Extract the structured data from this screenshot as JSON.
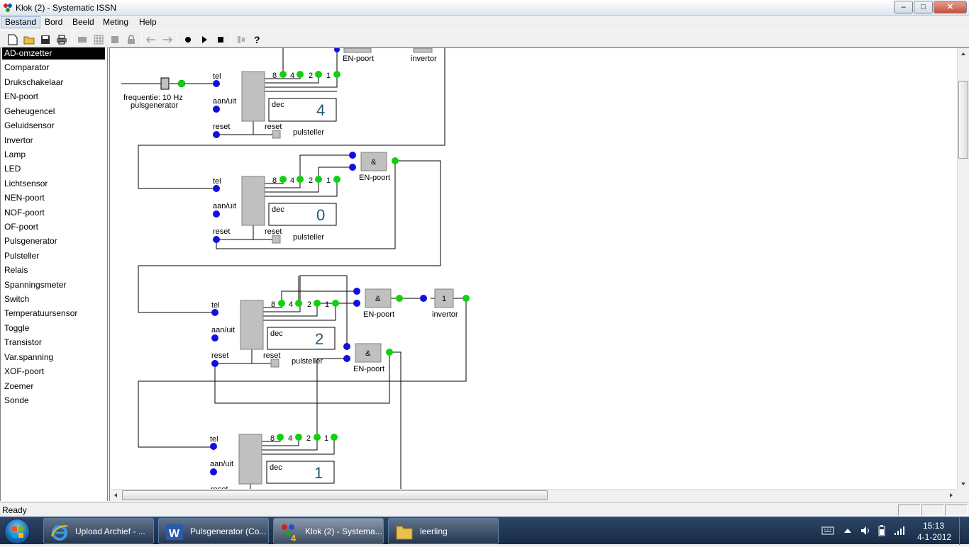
{
  "window": {
    "title": "Klok (2) - Systematic ISSN",
    "min": "‒",
    "max": "□",
    "close": "✕"
  },
  "menu": [
    "Bestand",
    "Bord",
    "Beeld",
    "Meting",
    "Help"
  ],
  "components": [
    "AD-omzetter",
    "Comparator",
    "Drukschakelaar",
    "EN-poort",
    "Geheugencel",
    "Geluidsensor",
    "Invertor",
    "Lamp",
    "LED",
    "Lichtsensor",
    "NEN-poort",
    "NOF-poort",
    "OF-poort",
    "Pulsgenerator",
    "Pulsteller",
    "Relais",
    "Spanningsmeter",
    "Switch",
    "Temperatuursensor",
    "Toggle",
    "Transistor",
    "Var.spanning",
    "XOF-poort",
    "Zoemer",
    "Sonde"
  ],
  "circuit": {
    "top_gate_label": "EN-poort",
    "top_inv_label": "invertor",
    "pulsgen_freq": "frequentie: 10 Hz",
    "pulsgen_label": "pulsgenerator",
    "pin_tel": "tel",
    "pin_aanuit": "aan/uit",
    "pin_reset": "reset",
    "bits": [
      "8",
      "4",
      "2",
      "1"
    ],
    "dec": "dec",
    "counter_label": "pulsteller",
    "gate_and": "&",
    "gate_label": "EN-poort",
    "inv_symbol": "1",
    "inv_label": "invertor",
    "counter_values": [
      "4",
      "0",
      "2",
      "1"
    ]
  },
  "status": "Ready",
  "taskbar": {
    "buttons": [
      "Upload Archief - ...",
      "Pulsgenerator (Co...",
      "Klok (2) - Systema...",
      "leerling"
    ],
    "time": "15:13",
    "date": "4-1-2012"
  },
  "colors": {
    "wire": "#000000",
    "pin_in": "#1010e0",
    "pin_out": "#10d010",
    "block": "#c0c0c0",
    "display_digit": "#1c5a6e"
  }
}
